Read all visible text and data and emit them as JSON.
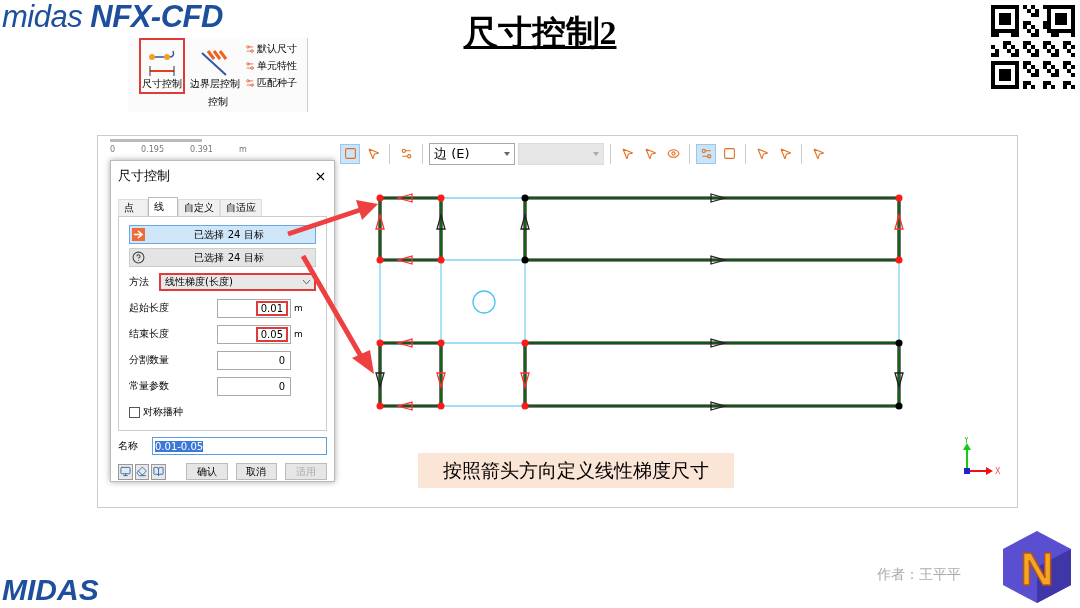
{
  "header": {
    "logo": "midas **NFX-CFD**",
    "title": "尺寸控制2"
  },
  "ribbon": {
    "large_buttons": [
      {
        "label": "尺寸控制",
        "highlighted": true
      },
      {
        "label": "边界层控制",
        "highlighted": false
      }
    ],
    "small_buttons": [
      "默认尺寸",
      "单元特性",
      "匹配种子"
    ],
    "group": "控制"
  },
  "toolbar": {
    "buttons": [
      {
        "selected": true
      },
      {
        "selected": false
      },
      {
        "selected": false
      }
    ],
    "selection_mode": "边 (E)",
    "buttons_2": [
      {
        "selected": false
      },
      {
        "selected": false
      },
      {
        "selected": false
      },
      {
        "selected": true
      },
      {
        "selected": false
      },
      {
        "selected": false
      },
      {
        "selected": false
      },
      {
        "selected": false
      }
    ]
  },
  "scale_bar": {
    "unit": "m",
    "ticks": [
      "0",
      "0.195",
      "0.391"
    ]
  },
  "dialog": {
    "title": "尺寸控制",
    "tabs": [
      {
        "label": "点",
        "selected": false
      },
      {
        "label": "线",
        "selected": true
      },
      {
        "label": "自定义",
        "selected": false
      },
      {
        "label": "自适应",
        "selected": false
      }
    ],
    "targets": [
      {
        "kind": "arrow",
        "label": "已选择 24 目标",
        "selected": true
      },
      {
        "kind": "question",
        "label": "已选择 24 目标",
        "selected": false
      }
    ],
    "method": {
      "label": "方法",
      "value": "线性梯度(长度)",
      "highlighted": true
    },
    "fields": [
      {
        "label": "起始长度",
        "value": "0.01",
        "unit": "m",
        "highlighted": true
      },
      {
        "label": "结束长度",
        "value": "0.05",
        "unit": "m",
        "highlighted": true
      },
      {
        "label": "分割数量",
        "value": "0",
        "highlighted": false
      },
      {
        "label": "常量参数",
        "value": "0",
        "highlighted": false
      }
    ],
    "checkbox": {
      "label": "对称播种",
      "checked": false
    },
    "name": {
      "label": "名称",
      "value": "0.01-0.05",
      "focused": true
    },
    "buttons": [
      {
        "label": "确认",
        "disabled": false
      },
      {
        "label": "取消",
        "disabled": false
      },
      {
        "label": "适用",
        "disabled": true
      }
    ]
  },
  "axes": {
    "x": "X",
    "y": "Y"
  },
  "caption": "按照箭头方向定义线性梯度尺寸",
  "footer": {
    "brand": "MIDAS",
    "author": "作者：王平平",
    "app_logo": "N"
  }
}
